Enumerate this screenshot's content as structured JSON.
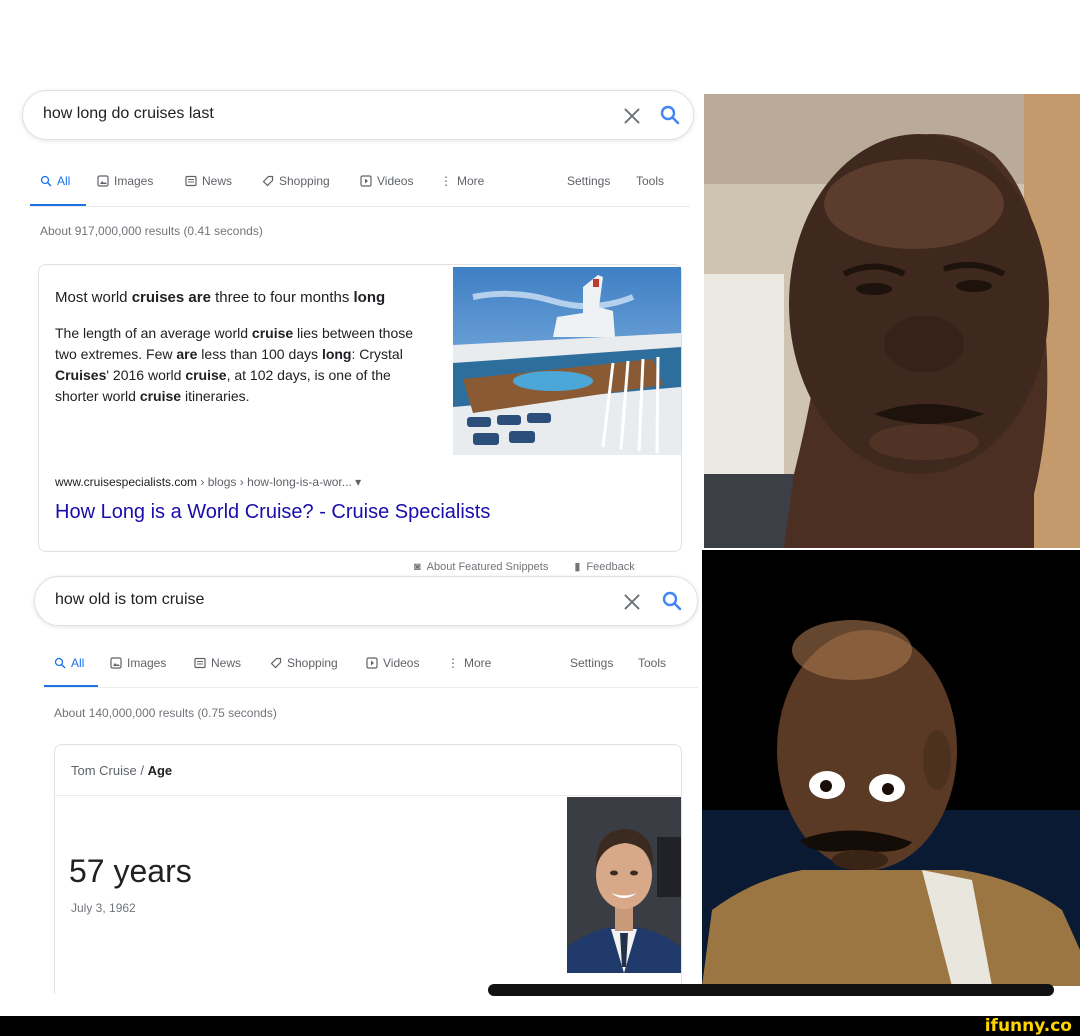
{
  "search1": {
    "query": "how long do cruises last",
    "tabs": [
      "All",
      "Images",
      "News",
      "Shopping",
      "Videos",
      "More"
    ],
    "settings_label": "Settings",
    "tools_label": "Tools",
    "result_stats": "About 917,000,000 results (0.41 seconds)",
    "snippet": {
      "heading_parts": [
        "Most world ",
        "cruises are",
        " three to four months ",
        "long"
      ],
      "body_parts": [
        "The length of an average world ",
        "cruise",
        " lies between those two extremes. Few ",
        "are",
        " less than 100 days ",
        "long",
        ": Crystal ",
        "Cruises",
        "' 2016 world ",
        "cruise",
        ", at 102 days, is one of the shorter world ",
        "cruise",
        " itineraries."
      ],
      "cite_domain": "www.cruisespecialists.com",
      "cite_path": " › blogs › how-long-is-a-wor... ▾",
      "link_title": "How Long is a World Cruise? - Cruise Specialists",
      "image_alt": "cruise-ship-deck-photo"
    },
    "about_snippets": "About Featured Snippets",
    "feedback": "Feedback"
  },
  "search2": {
    "query": "how old is tom cruise",
    "tabs": [
      "All",
      "Images",
      "News",
      "Shopping",
      "Videos",
      "More"
    ],
    "settings_label": "Settings",
    "tools_label": "Tools",
    "result_stats": "About 140,000,000 results (0.75 seconds)",
    "knowledge": {
      "subject": "Tom Cruise",
      "separator": " / ",
      "attribute": "Age",
      "value": "57 years",
      "birth_date": "July 3, 1962"
    }
  },
  "watermark": "ifunny.co",
  "colors": {
    "accent": "#1a73e8",
    "link": "#1a0dab",
    "watermark": "#ffd400"
  }
}
